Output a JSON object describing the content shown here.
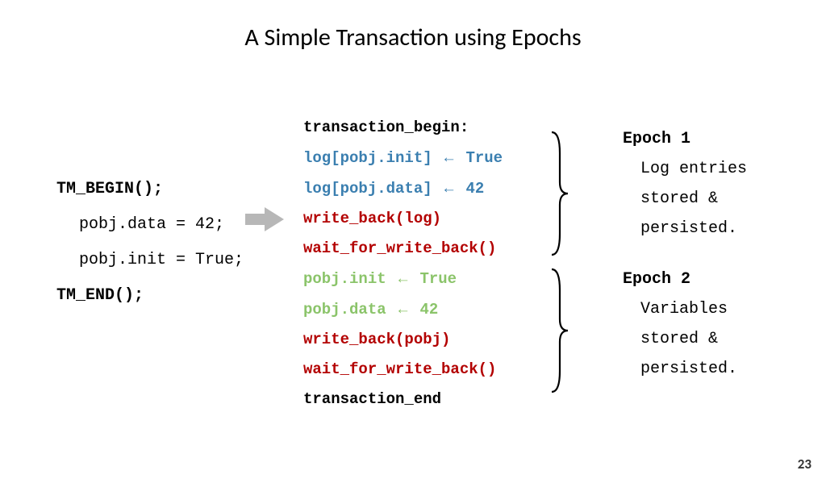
{
  "title": "A Simple Transaction using Epochs",
  "left": {
    "l1": "TM_BEGIN();",
    "l2": "pobj.data = 42;",
    "l3": "pobj.init = True;",
    "l4": "TM_END();"
  },
  "mid": {
    "l1": "transaction_begin:",
    "l2a": "log[pobj.init]",
    "l2b": "True",
    "l3a": "log[pobj.data]",
    "l3b": "42",
    "l4": "write_back(log)",
    "l5": "wait_for_write_back()",
    "l6a": "pobj.init",
    "l6b": "True",
    "l7a": "pobj.data",
    "l7b": "42",
    "l8": "write_back(pobj)",
    "l9": "wait_for_write_back()",
    "l10": "transaction_end",
    "arrow": "←"
  },
  "epoch1": {
    "heading": "Epoch 1",
    "b1": "Log entries",
    "b2": "stored &",
    "b3": "persisted."
  },
  "epoch2": {
    "heading": "Epoch 2",
    "b1": "Variables",
    "b2": "stored &",
    "b3": "persisted."
  },
  "page": "23"
}
